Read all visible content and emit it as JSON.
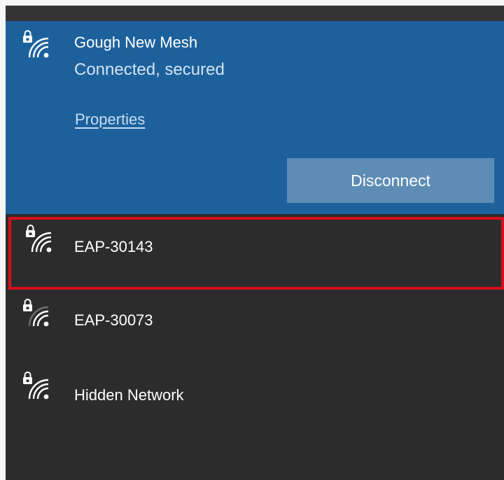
{
  "connected_network": {
    "name": "Gough New Mesh",
    "status": "Connected, secured",
    "properties_label": "Properties",
    "disconnect_label": "Disconnect",
    "icon": "secured-wifi-icon"
  },
  "networks": [
    {
      "name": "EAP-30143",
      "icon": "secured-wifi-icon",
      "highlighted": true
    },
    {
      "name": "EAP-30073",
      "icon": "secured-wifi-weak-icon",
      "highlighted": false
    },
    {
      "name": "Hidden Network",
      "icon": "secured-wifi-icon",
      "highlighted": false
    }
  ],
  "colors": {
    "panel_background": "#2c2c2c",
    "connected_background": "#1d619c",
    "button_background": "#5d8cb4",
    "highlight_border": "#d3101b"
  }
}
